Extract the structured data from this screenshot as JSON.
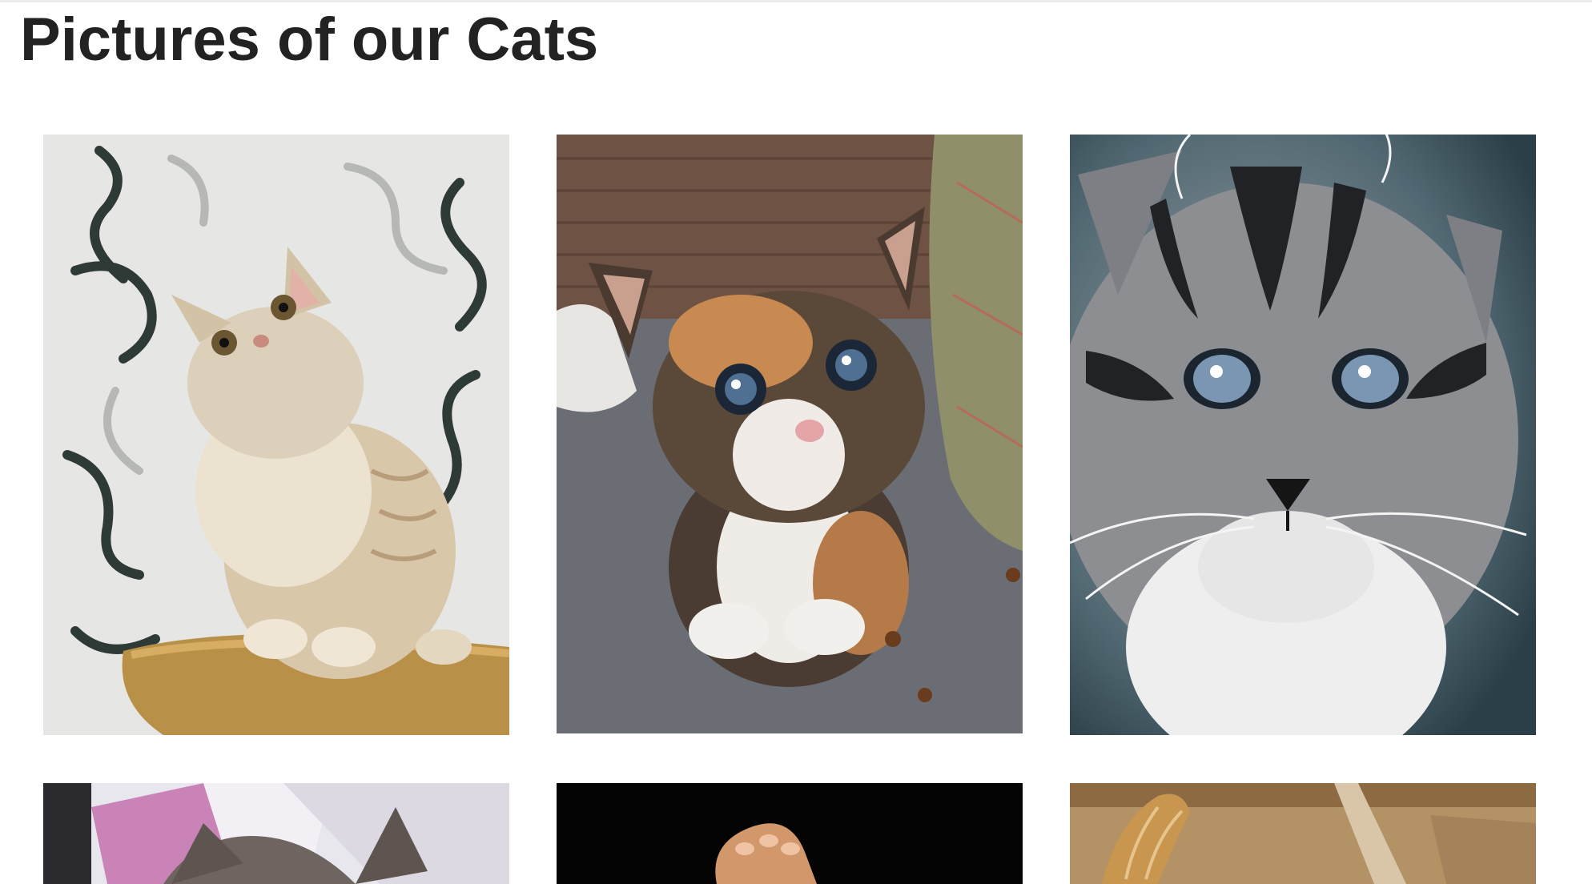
{
  "page": {
    "title": "Pictures of our Cats"
  },
  "gallery": {
    "photos": [
      {
        "subject": "cream tabby kitten sitting on a cat tree",
        "colors": {
          "bg": "#e4e4e2",
          "fur": "#d8c6a8",
          "accent": "#2f3a34"
        }
      },
      {
        "subject": "calico kitten crouching on a grey floor",
        "colors": {
          "bg": "#6c7076",
          "fur": "#7a5a3e",
          "accent": "#e9e4de"
        }
      },
      {
        "subject": "grey tabby kitten close-up with blue eyes",
        "colors": {
          "bg": "#38505a",
          "fur": "#8e8e90",
          "accent": "#f2f2f2"
        }
      },
      {
        "subject": "tabby kitten on pink blanket",
        "colors": {
          "bg": "#c98fb8",
          "fur": "#6b5f57",
          "accent": "#eeeeee"
        }
      },
      {
        "subject": "kitten paw against black background",
        "colors": {
          "bg": "#050505",
          "fur": "#d49a72",
          "accent": "#f1c7a8"
        }
      },
      {
        "subject": "ginger kitten on wooden floor",
        "colors": {
          "bg": "#b59467",
          "fur": "#c99a5e",
          "accent": "#e8d8c0"
        }
      }
    ]
  }
}
